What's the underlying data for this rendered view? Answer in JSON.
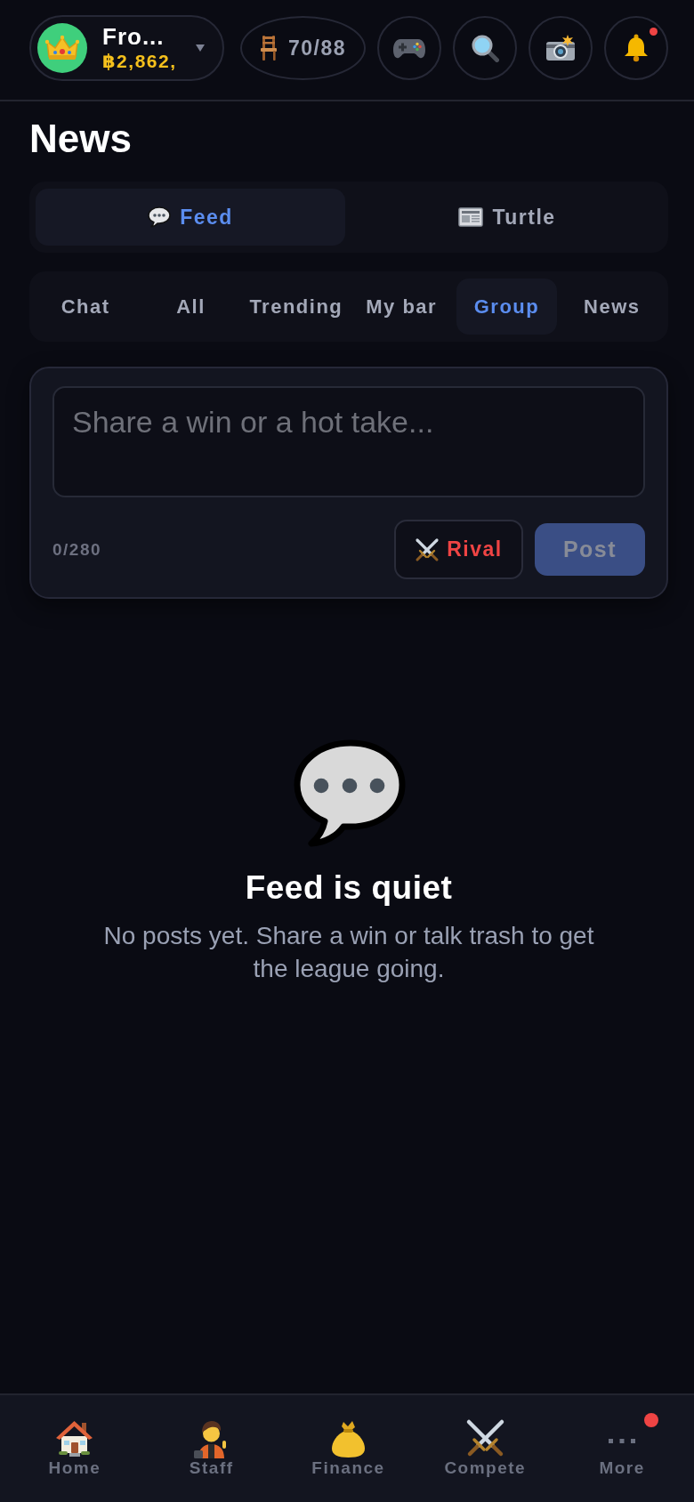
{
  "header": {
    "profile": {
      "name": "Fro...",
      "balance": "฿2,862,"
    },
    "seats": "70/88",
    "icon_buttons": [
      {
        "badge": false
      },
      {
        "badge": false
      },
      {
        "badge": false
      },
      {
        "badge": true
      }
    ]
  },
  "title": "News",
  "view_tabs": [
    {
      "label": "Feed",
      "selected": true
    },
    {
      "label": "Turtle",
      "selected": false
    }
  ],
  "filters": [
    {
      "label": "Chat",
      "selected": false
    },
    {
      "label": "All",
      "selected": false
    },
    {
      "label": "Trending",
      "selected": false
    },
    {
      "label": "My bar",
      "selected": false
    },
    {
      "label": "Group",
      "selected": true
    },
    {
      "label": "News",
      "selected": false
    }
  ],
  "composer": {
    "placeholder": "Share a win or a hot take...",
    "counter": "0/280",
    "rival_button": "Rival",
    "post_button": {
      "label": "Post",
      "disabled": true
    }
  },
  "empty_state": {
    "title": "Feed is quiet",
    "message": "No posts yet. Share a win or talk trash to get the league going."
  },
  "bottom_nav": [
    {
      "label": "Home",
      "badge": false
    },
    {
      "label": "Staff",
      "badge": false
    },
    {
      "label": "Finance",
      "badge": false
    },
    {
      "label": "Compete",
      "badge": false
    },
    {
      "label": "More",
      "badge": true
    }
  ]
}
